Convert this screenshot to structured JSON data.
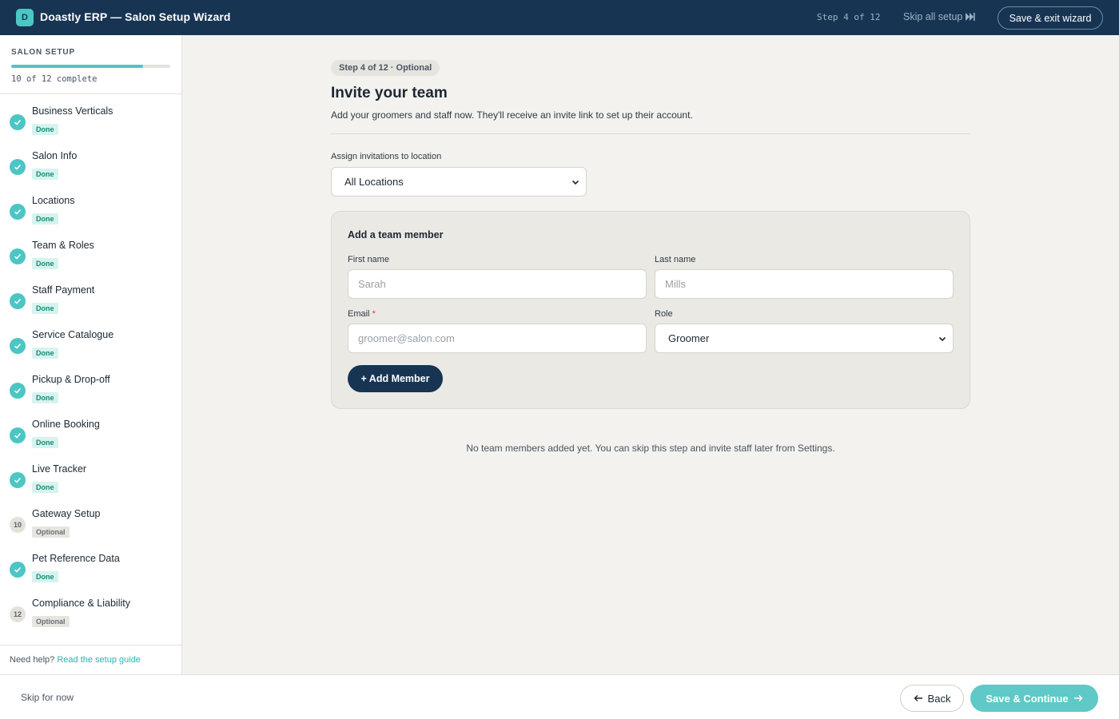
{
  "header": {
    "logo_letter": "D",
    "title": "Doastly ERP — Salon Setup Wizard",
    "step_text": "Step 4 of 12",
    "skip_all_label": "Skip all setup",
    "save_exit_label": "Save & exit wizard"
  },
  "sidebar": {
    "title": "SALON SETUP",
    "progress_fraction": 0.83,
    "progress_label": "10 of 12 complete",
    "items": [
      {
        "label": "Business Verticals",
        "status": "done",
        "badge": "Done"
      },
      {
        "label": "Salon Info",
        "status": "done",
        "badge": "Done"
      },
      {
        "label": "Locations",
        "status": "done",
        "badge": "Done"
      },
      {
        "label": "Team & Roles",
        "status": "done",
        "badge": "Done"
      },
      {
        "label": "Staff Payment",
        "status": "done",
        "badge": "Done"
      },
      {
        "label": "Service Catalogue",
        "status": "done",
        "badge": "Done"
      },
      {
        "label": "Pickup & Drop-off",
        "status": "done",
        "badge": "Done"
      },
      {
        "label": "Online Booking",
        "status": "done",
        "badge": "Done"
      },
      {
        "label": "Live Tracker",
        "status": "done",
        "badge": "Done"
      },
      {
        "label": "Gateway Setup",
        "status": "optional",
        "badge": "Optional",
        "number": "10"
      },
      {
        "label": "Pet Reference Data",
        "status": "done",
        "badge": "Done"
      },
      {
        "label": "Compliance & Liability",
        "status": "optional",
        "badge": "Optional",
        "number": "12"
      }
    ],
    "help_text": "Need help?",
    "help_link": "Read the setup guide"
  },
  "main": {
    "step_pill": "Step 4 of 12 · Optional",
    "title": "Invite your team",
    "subtitle": "Add your groomers and staff now. They'll receive an invite link to set up their account.",
    "location_label": "Assign invitations to location",
    "location_value": "All Locations",
    "card": {
      "title": "Add a team member",
      "first_name_label": "First name",
      "first_name_placeholder": "Sarah",
      "last_name_label": "Last name",
      "last_name_placeholder": "Mills",
      "email_label": "Email",
      "email_required": "*",
      "email_placeholder": "groomer@salon.com",
      "role_label": "Role",
      "role_value": "Groomer",
      "add_button": "+ Add Member"
    },
    "empty_text": "No team members added yet. You can skip this step and invite staff later from Settings."
  },
  "footer": {
    "skip_label": "Skip for now",
    "back_label": "Back",
    "continue_label": "Save & Continue"
  },
  "colors": {
    "navy": "#173553",
    "teal": "#4cc6c4",
    "background": "#f3f2ee"
  }
}
